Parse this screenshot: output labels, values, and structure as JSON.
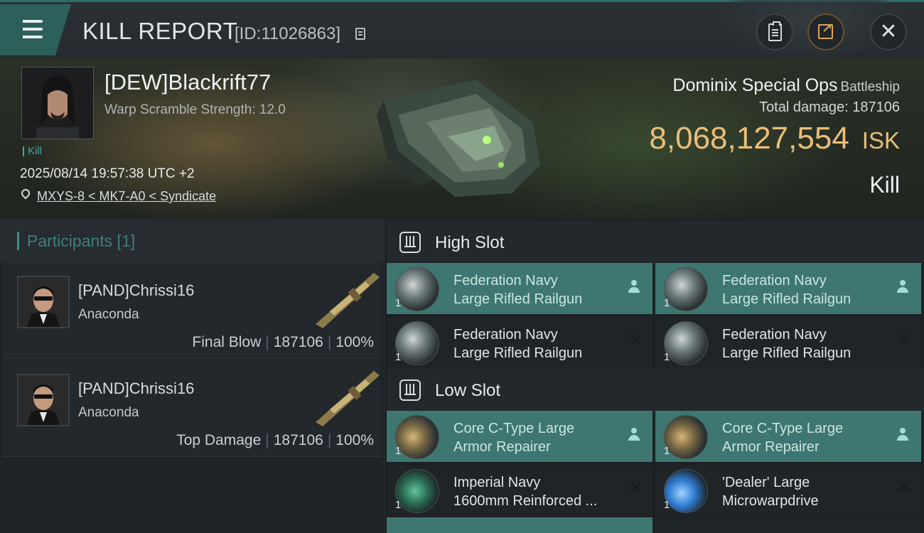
{
  "header": {
    "title": "KILL REPORT",
    "report_id": "[ID:11026863]",
    "icons": {
      "menu": "hamburger-menu-icon",
      "clipboard": "clipboard-icon",
      "share": "share-icon",
      "close": "close-icon"
    }
  },
  "victim": {
    "name": "[DEW]Blackrift77",
    "warp_scramble": "Warp Scramble Strength: 12.0",
    "kill_tag": "Kill",
    "datetime": "2025/08/14 19:57:38 UTC +2",
    "location": "MXYS-8 < MK7-A0 < Syndicate"
  },
  "ship": {
    "name": "Dominix Special Ops",
    "class": "Battleship",
    "total_damage": "Total damage:  187106",
    "isk_value": "8,068,127,554",
    "isk_unit": "ISK",
    "result": "Kill"
  },
  "participants": {
    "title": "Participants [1]",
    "rows": [
      {
        "name": "[PAND]Chrissi16",
        "ship": "Anaconda",
        "role": "Final Blow",
        "damage": "187106",
        "percent": "100%"
      },
      {
        "name": "[PAND]Chrissi16",
        "ship": "Anaconda",
        "role": "Top Damage",
        "damage": "187106",
        "percent": "100%"
      }
    ]
  },
  "fitting": {
    "high_slot_label": "High Slot",
    "low_slot_label": "Low Slot",
    "high": [
      {
        "line1": "Federation Navy",
        "line2": "Large Rifled Railgun",
        "qty": "1",
        "status": "dropped"
      },
      {
        "line1": "Federation Navy",
        "line2": "Large Rifled Railgun",
        "qty": "1",
        "status": "dropped"
      },
      {
        "line1": "Federation Navy",
        "line2": "Large Rifled Railgun",
        "qty": "1",
        "status": "destroyed"
      },
      {
        "line1": "Federation Navy",
        "line2": "Large Rifled Railgun",
        "qty": "1",
        "status": "destroyed"
      }
    ],
    "low": [
      {
        "line1": "Core C-Type Large",
        "line2": "Armor Repairer",
        "qty": "1",
        "status": "dropped"
      },
      {
        "line1": "Core C-Type Large",
        "line2": "Armor Repairer",
        "qty": "1",
        "status": "dropped"
      },
      {
        "line1": "Imperial Navy",
        "line2": "1600mm Reinforced ...",
        "qty": "1",
        "status": "destroyed"
      },
      {
        "line1": "'Dealer' Large",
        "line2": "Microwarpdrive",
        "qty": "1",
        "status": "destroyed"
      }
    ]
  },
  "colors": {
    "accent_teal": "#3e7671",
    "isk_gold": "#e9be7a",
    "brand_dark": "#1c2024"
  }
}
